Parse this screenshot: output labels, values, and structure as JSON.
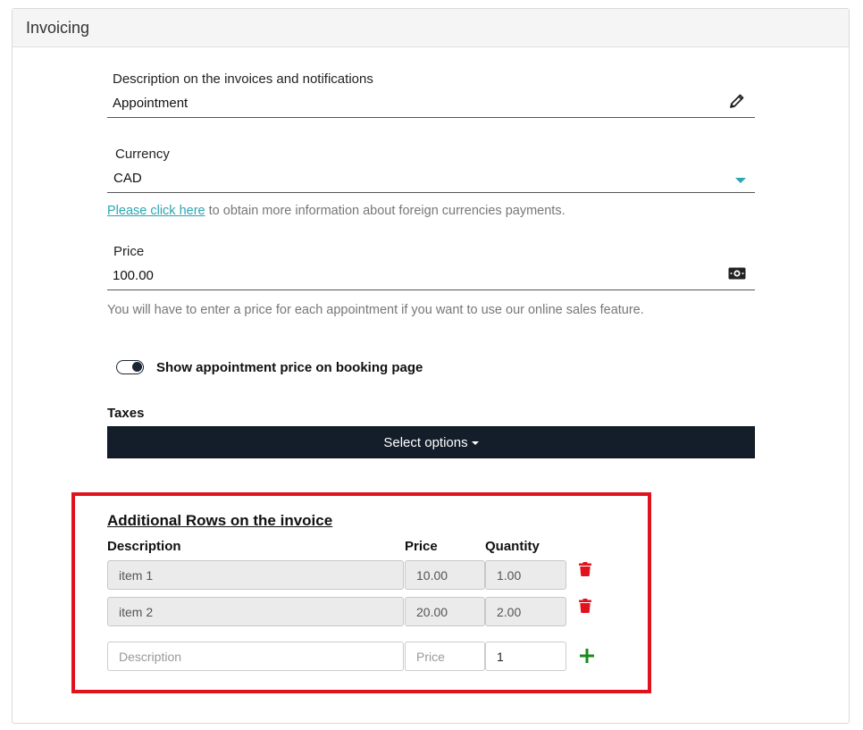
{
  "panel": {
    "title": "Invoicing"
  },
  "description_field": {
    "label": "Description on the invoices and notifications",
    "value": "Appointment",
    "icon": "pencil-icon"
  },
  "currency_field": {
    "label": "Currency",
    "value": "CAD",
    "icon": "caret-down-icon"
  },
  "currency_help": {
    "link_text": "Please click here",
    "text": " to obtain more information about foreign currencies payments."
  },
  "price_field": {
    "label": "Price",
    "value": "100.00",
    "icon": "money-icon",
    "help": "You will have to enter a price for each appointment if you want to use our online sales feature."
  },
  "show_price_toggle": {
    "label": "Show appointment price on booking page",
    "on": true
  },
  "taxes": {
    "label": "Taxes",
    "button_label": "Select options"
  },
  "additional_rows": {
    "title": "Additional Rows on the invoice",
    "headers": {
      "description": "Description",
      "price": "Price",
      "quantity": "Quantity"
    },
    "rows": [
      {
        "description": "item 1",
        "price": "10.00",
        "quantity": "1.00"
      },
      {
        "description": "item 2",
        "price": "20.00",
        "quantity": "2.00"
      }
    ],
    "new_row": {
      "description_placeholder": "Description",
      "price_placeholder": "Price",
      "quantity_value": "1"
    }
  },
  "colors": {
    "accent": "#2aa7b0",
    "dark_button": "#141e2a",
    "delete": "#e0121e",
    "add": "#1a8a1a",
    "highlight": "#e0121e"
  }
}
